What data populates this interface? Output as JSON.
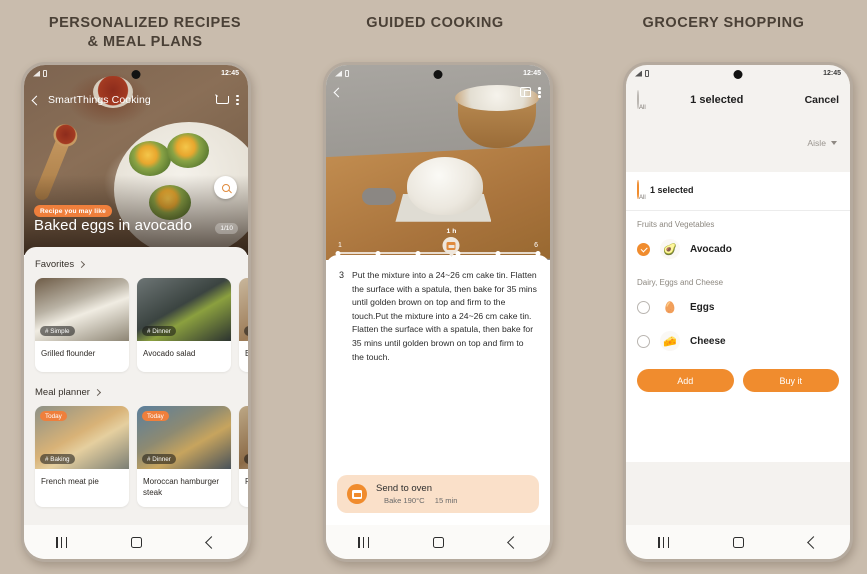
{
  "panels": [
    {
      "headline": "PERSONALIZED RECIPES\n& MEAL PLANS"
    },
    {
      "headline": "GUIDED COOKING"
    },
    {
      "headline": "GROCERY SHOPPING"
    }
  ],
  "status_bar": {
    "time": "12:45"
  },
  "phone1": {
    "app_title": "SmartThings Cooking",
    "hero": {
      "badge": "Recipe you may like",
      "title": "Baked eggs in avocado",
      "pager": "1/10"
    },
    "sections": [
      {
        "title": "Favorites",
        "cards": [
          {
            "tag": "# Simple",
            "name": "Grilled flounder"
          },
          {
            "tag": "# Dinner",
            "name": "Avocado salad"
          },
          {
            "tag": "# L",
            "name": "Bac"
          }
        ]
      },
      {
        "title": "Meal planner",
        "cards": [
          {
            "today": "Today",
            "tag": "# Baking",
            "name": "French meat pie"
          },
          {
            "today": "Today",
            "tag": "# Dinner",
            "name": "Moroccan hamburger steak"
          },
          {
            "today": "",
            "tag": "# B",
            "name": "Fren"
          }
        ]
      }
    ]
  },
  "phone2": {
    "slider": {
      "start": "1",
      "end": "6",
      "pin_label": "1 h",
      "dots": 6,
      "active_index": 4
    },
    "step": {
      "number": "3",
      "text": "Put the mixture into a 24~26 cm cake tin. Flatten the surface with a spatula, then bake for 35 mins until golden brown on top and firm to the touch.Put the mixture into a 24~26 cm cake tin. Flatten the surface with a spatula, then bake for 35 mins until golden brown on top and firm to the touch."
    },
    "oven": {
      "title": "Send to oven",
      "mode": "Bake 190°C",
      "duration": "15 min"
    }
  },
  "phone3": {
    "header": {
      "selected": "1 selected",
      "all_label": "All",
      "cancel": "Cancel",
      "sort": "Aisle"
    },
    "list_all": {
      "selected": "1 selected",
      "all_label": "All"
    },
    "groups": [
      {
        "title": "Fruits and Vegetables",
        "items": [
          {
            "name": "Avocado",
            "checked": true,
            "emoji": "🥑"
          }
        ]
      },
      {
        "title": "Dairy, Eggs and Cheese",
        "items": [
          {
            "name": "Eggs",
            "checked": false,
            "emoji": "🥚"
          },
          {
            "name": "Cheese",
            "checked": false,
            "emoji": "🧀"
          }
        ]
      }
    ],
    "buttons": {
      "add": "Add",
      "buy": "Buy it"
    }
  },
  "colors": {
    "accent": "#f08c2e",
    "badge": "#ef7f3c",
    "background": "#c9bcad"
  }
}
